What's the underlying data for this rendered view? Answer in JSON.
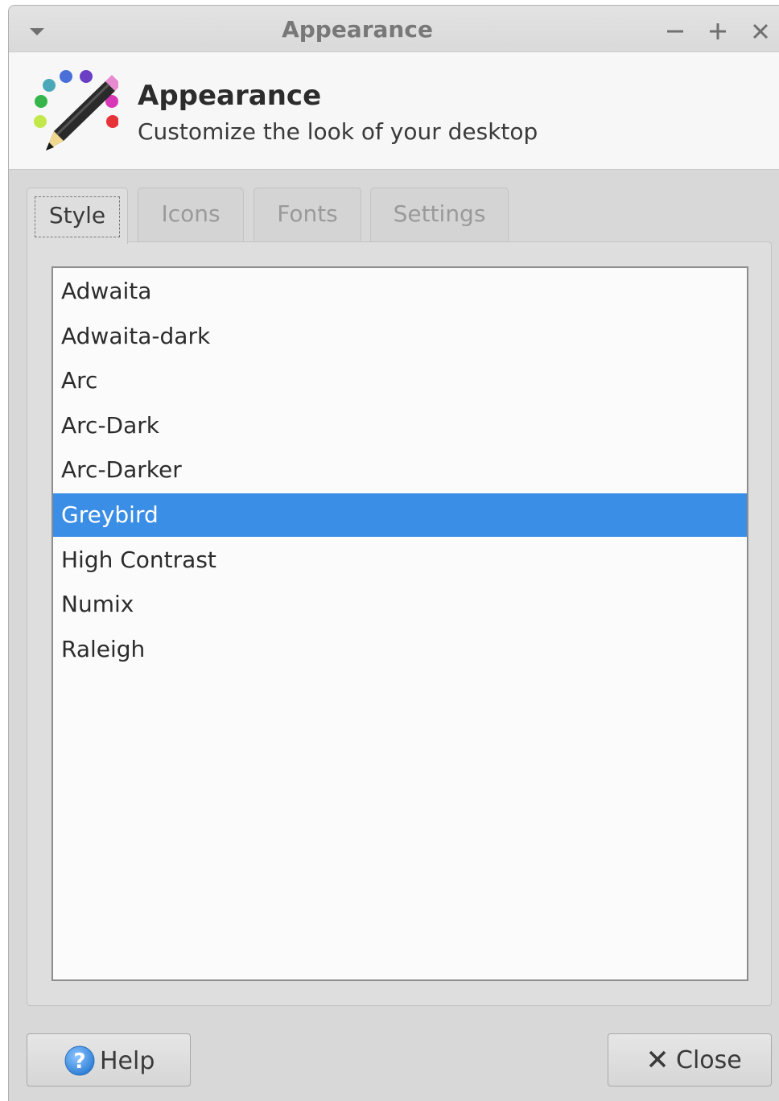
{
  "window": {
    "title": "Appearance"
  },
  "header": {
    "title": "Appearance",
    "subtitle": "Customize the look of your desktop"
  },
  "tabs": [
    {
      "label": "Style",
      "active": true
    },
    {
      "label": "Icons",
      "active": false
    },
    {
      "label": "Fonts",
      "active": false
    },
    {
      "label": "Settings",
      "active": false
    }
  ],
  "themes": {
    "items": [
      "Adwaita",
      "Adwaita-dark",
      "Arc",
      "Arc-Dark",
      "Arc-Darker",
      "Greybird",
      "High Contrast",
      "Numix",
      "Raleigh"
    ],
    "selected": "Greybird"
  },
  "buttons": {
    "help_label": "Help",
    "close_label": "Close"
  },
  "colors": {
    "selection": "#3a8ee6",
    "window_bg": "#d8d8d8"
  }
}
